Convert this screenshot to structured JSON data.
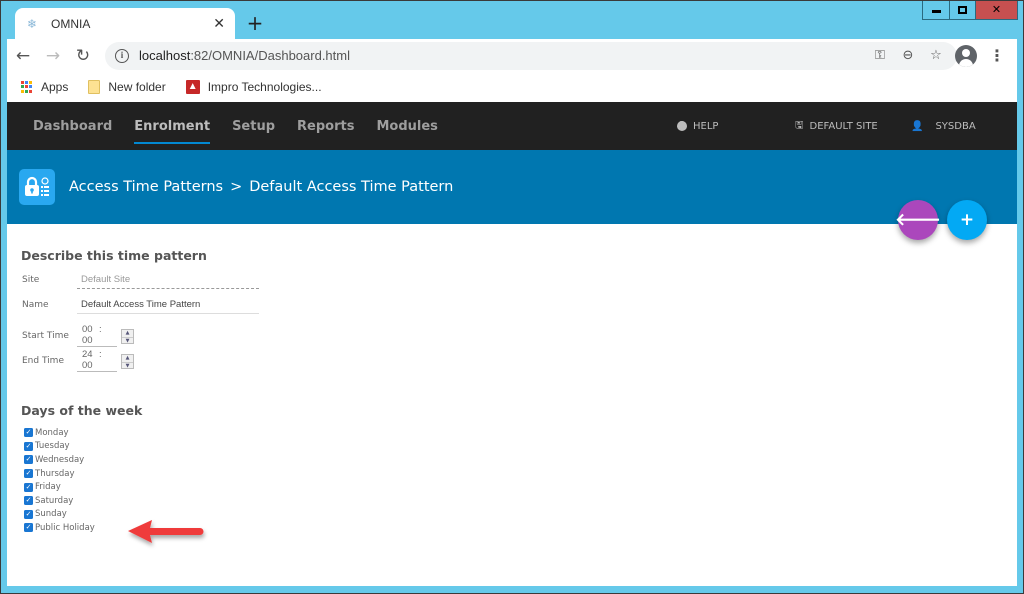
{
  "browser": {
    "tab_title": "OMNIA",
    "tab_close": "✕",
    "new_tab": "+",
    "url_host": "localhost",
    "url_rest": ":82/OMNIA/Dashboard.html",
    "bookmarks": [
      {
        "label": "Apps",
        "icon": "apps-grid-icon"
      },
      {
        "label": "New folder",
        "icon": "folder-icon"
      },
      {
        "label": "Impro Technologies...",
        "icon": "impro-icon"
      }
    ],
    "toolbar_icons": [
      "key-icon",
      "zoom-out-icon",
      "star-icon",
      "profile-icon",
      "menu-icon"
    ]
  },
  "window_controls": [
    "minimize",
    "maximize",
    "close"
  ],
  "topnav": {
    "items": [
      {
        "label": "Dashboard",
        "active": false
      },
      {
        "label": "Enrolment",
        "active": true
      },
      {
        "label": "Setup",
        "active": false
      },
      {
        "label": "Reports",
        "active": false
      },
      {
        "label": "Modules",
        "active": false
      }
    ],
    "help": "HELP",
    "site": "DEFAULT SITE",
    "user": "SYSDBA"
  },
  "header": {
    "breadcrumb_parent": "Access Time Patterns",
    "breadcrumb_sep": ">",
    "breadcrumb_current": "Default Access Time Pattern",
    "back_icon": "arrow-left",
    "add_icon": "plus"
  },
  "form": {
    "section_title": "Describe this time pattern",
    "site_label": "Site",
    "site_value": "Default Site",
    "name_label": "Name",
    "name_value": "Default Access Time Pattern",
    "start_label": "Start Time",
    "start_hh": "00",
    "start_mm": "00",
    "end_label": "End Time",
    "end_hh": "24",
    "end_mm": "00",
    "colon": ":"
  },
  "days": {
    "section_title": "Days of the week",
    "items": [
      {
        "label": "Monday",
        "checked": true
      },
      {
        "label": "Tuesday",
        "checked": true
      },
      {
        "label": "Wednesday",
        "checked": true
      },
      {
        "label": "Thursday",
        "checked": true
      },
      {
        "label": "Friday",
        "checked": true
      },
      {
        "label": "Saturday",
        "checked": true
      },
      {
        "label": "Sunday",
        "checked": true
      },
      {
        "label": "Public Holiday",
        "checked": true
      }
    ]
  },
  "colors": {
    "nav_bg": "#212121",
    "header_bg": "#0077b0",
    "back_fab": "#ab47bc",
    "add_fab": "#03a9f4",
    "annotation_arrow": "#ef3b3b",
    "checkbox": "#1976d2"
  }
}
